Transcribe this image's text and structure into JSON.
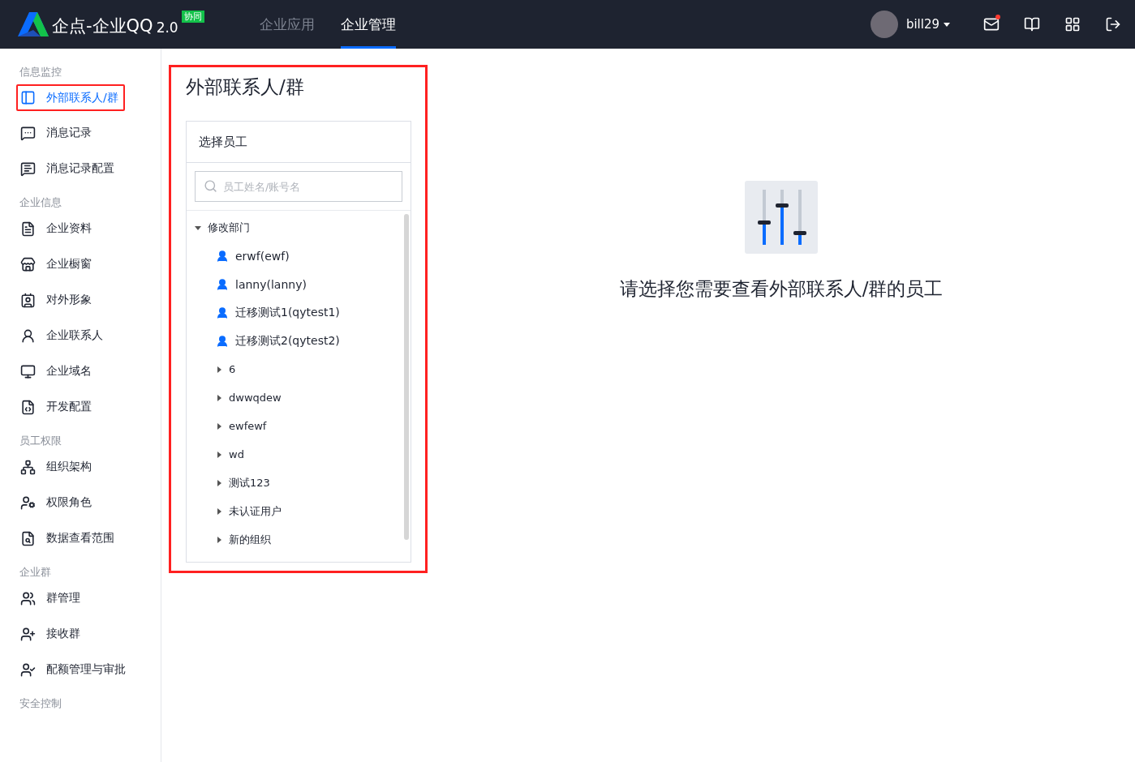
{
  "header": {
    "logo_text": "企点-企业QQ",
    "version": "2.0",
    "badge": "协同",
    "nav": [
      {
        "label": "企业应用",
        "selected": false
      },
      {
        "label": "企业管理",
        "selected": true
      }
    ],
    "user": {
      "name": "bill29"
    },
    "mail_unread": true
  },
  "sidebar": {
    "sections": [
      {
        "title": "信息监控",
        "items": [
          {
            "label": "外部联系人/群",
            "selected": true
          },
          {
            "label": "消息记录",
            "selected": false
          },
          {
            "label": "消息记录配置",
            "selected": false
          }
        ]
      },
      {
        "title": "企业信息",
        "items": [
          {
            "label": "企业资料",
            "selected": false
          },
          {
            "label": "企业橱窗",
            "selected": false
          },
          {
            "label": "对外形象",
            "selected": false
          },
          {
            "label": "企业联系人",
            "selected": false
          },
          {
            "label": "企业域名",
            "selected": false
          },
          {
            "label": "开发配置",
            "selected": false
          }
        ]
      },
      {
        "title": "员工权限",
        "items": [
          {
            "label": "组织架构",
            "selected": false
          },
          {
            "label": "权限角色",
            "selected": false
          },
          {
            "label": "数据查看范围",
            "selected": false
          }
        ]
      },
      {
        "title": "企业群",
        "items": [
          {
            "label": "群管理",
            "selected": false
          },
          {
            "label": "接收群",
            "selected": false
          },
          {
            "label": "配额管理与审批",
            "selected": false
          }
        ]
      },
      {
        "title": "安全控制"
      }
    ]
  },
  "panel": {
    "title": "外部联系人/群",
    "card_title": "选择员工",
    "search": {
      "placeholder": "员工姓名/账号名"
    },
    "tree": [
      {
        "kind": "dept",
        "label": "修改部门",
        "expanded": true,
        "children": [
          {
            "kind": "user",
            "label": "erwf(ewf)"
          },
          {
            "kind": "user",
            "label": "lanny(lanny)"
          },
          {
            "kind": "user",
            "label": "迁移测试1(qytest1)"
          },
          {
            "kind": "user",
            "label": "迁移测试2(qytest2)"
          },
          {
            "kind": "dept",
            "label": "6",
            "expanded": false
          },
          {
            "kind": "dept",
            "label": "dwwqdew",
            "expanded": false
          },
          {
            "kind": "dept",
            "label": "ewfewf",
            "expanded": false
          },
          {
            "kind": "dept",
            "label": "wd",
            "expanded": false
          },
          {
            "kind": "dept",
            "label": "测试123",
            "expanded": false
          },
          {
            "kind": "dept",
            "label": "未认证用户",
            "expanded": false
          },
          {
            "kind": "dept",
            "label": "新的组织",
            "expanded": false
          }
        ]
      }
    ]
  },
  "empty_state": {
    "message": "请选择您需要查看外部联系人/群的员工"
  }
}
